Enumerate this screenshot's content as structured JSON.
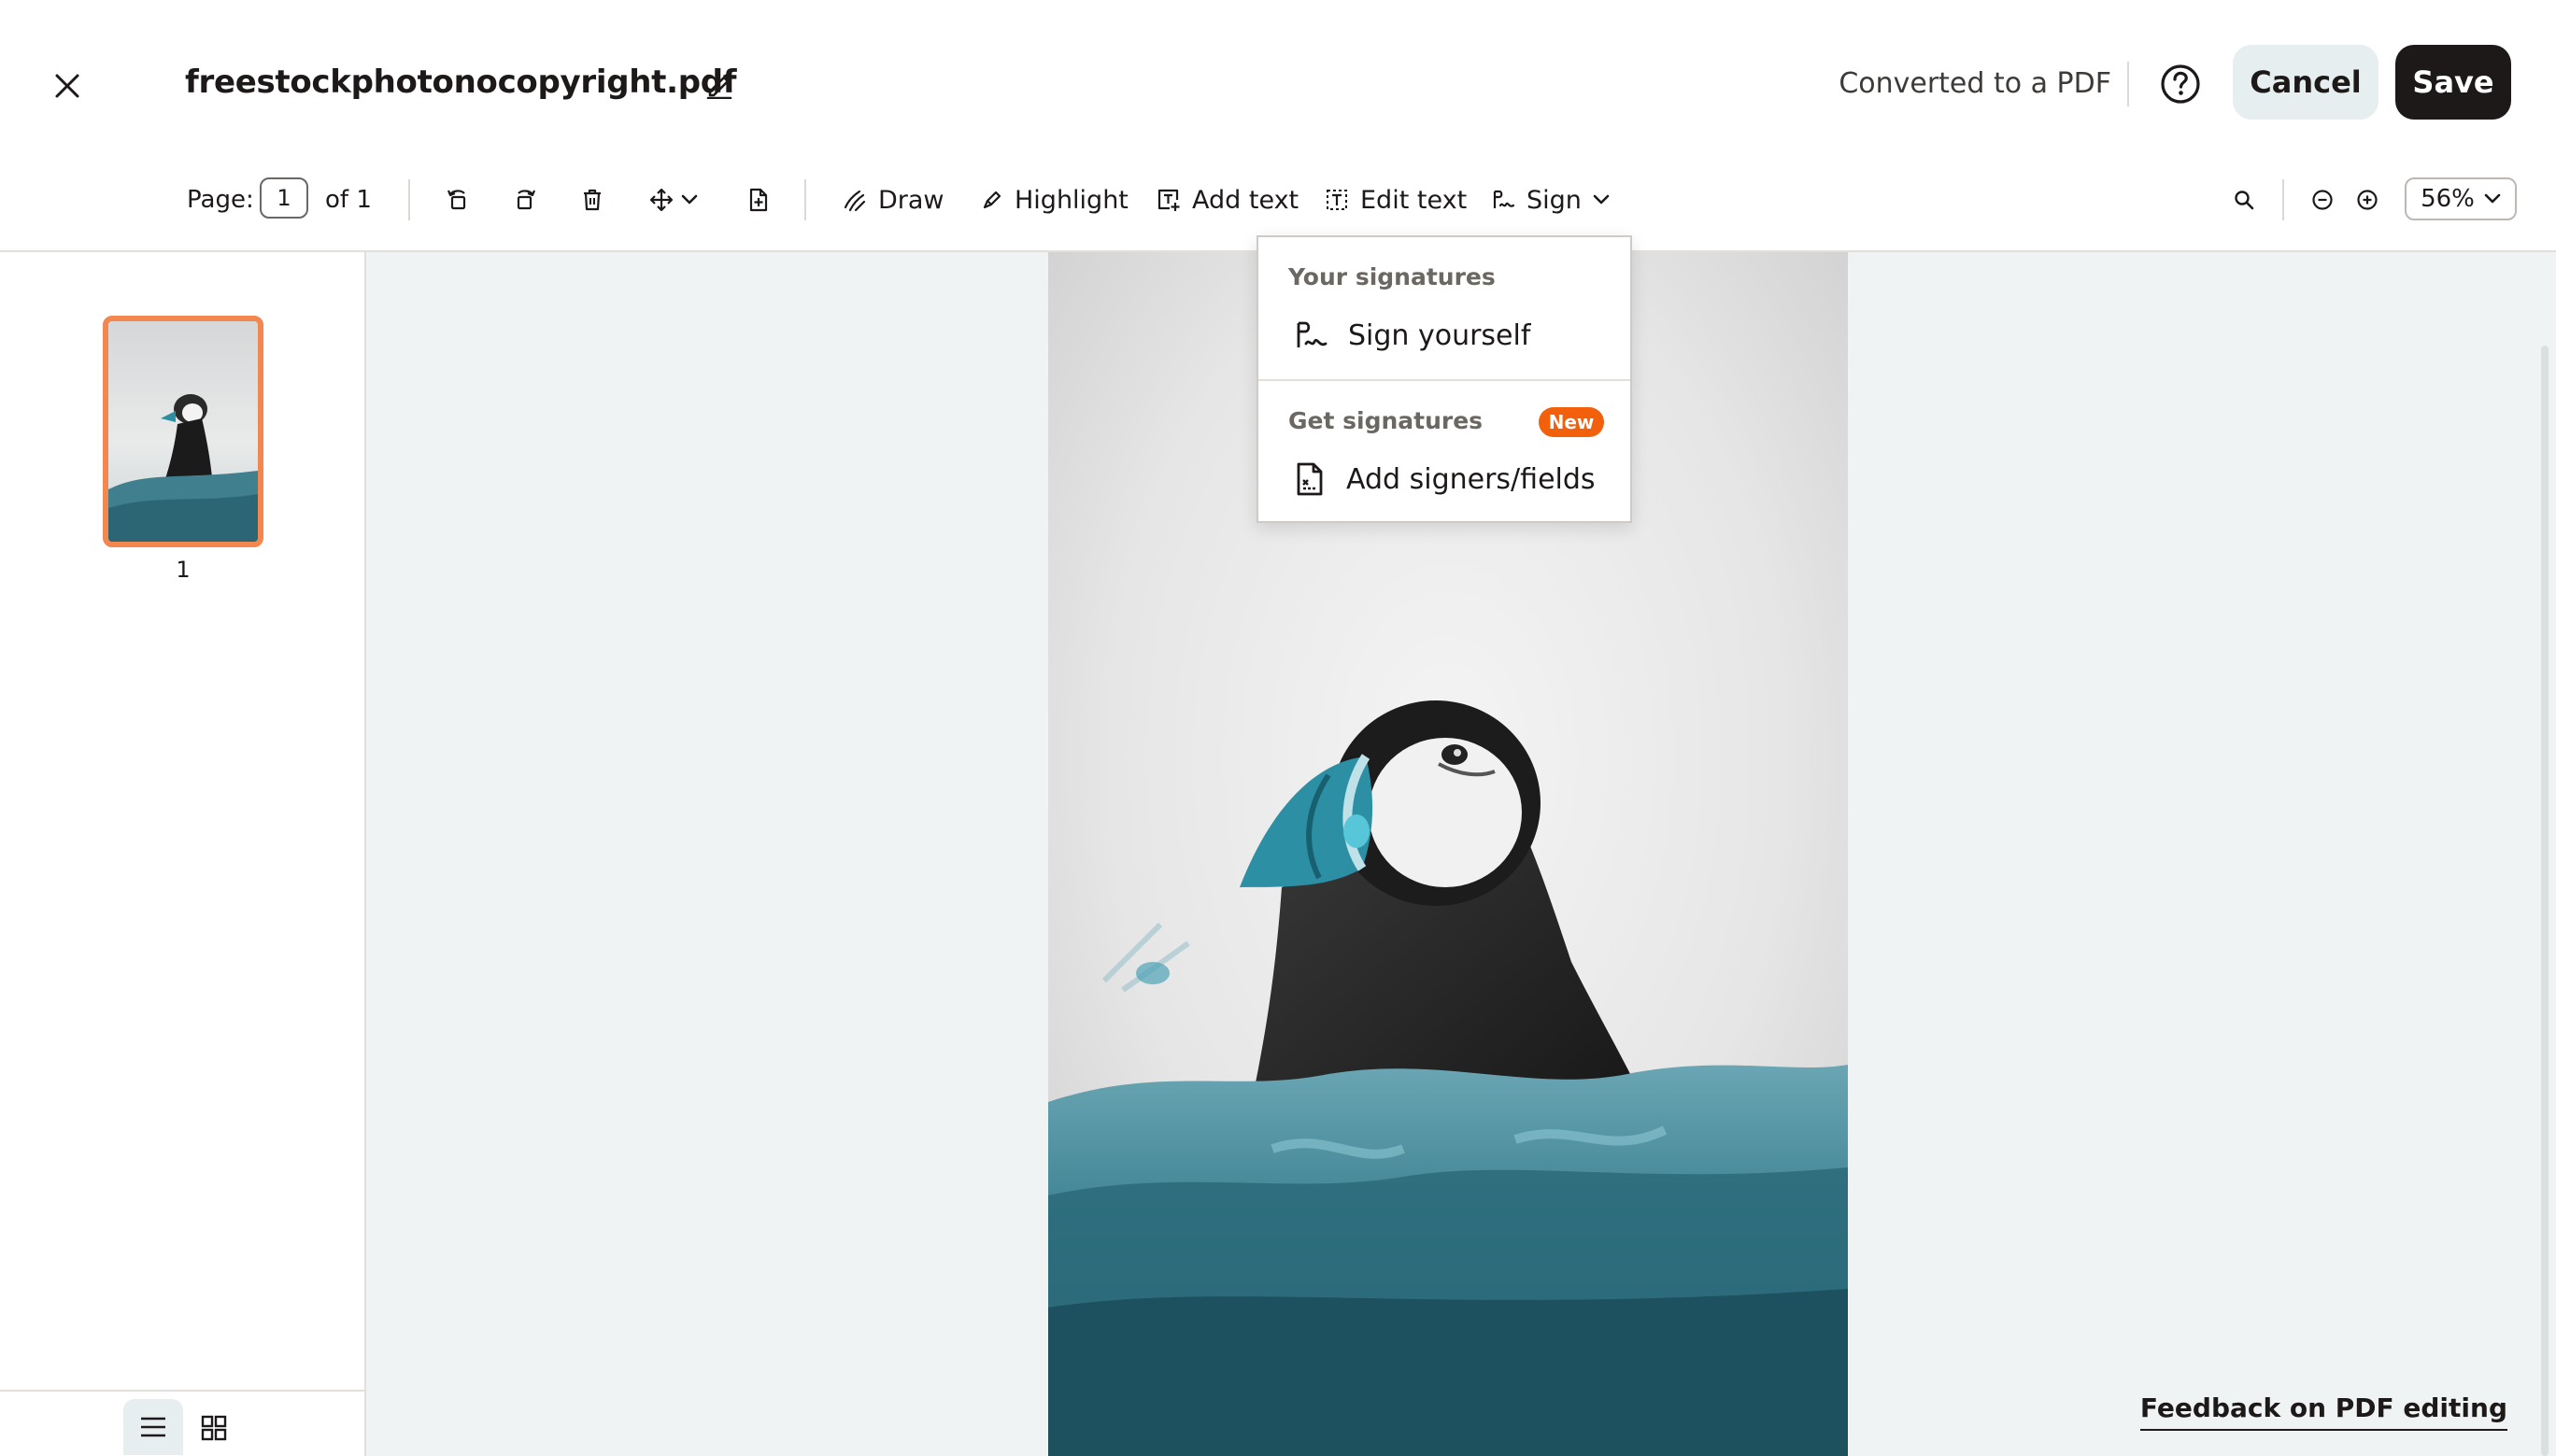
{
  "header": {
    "file_name": "freestockphotonocopyright.pdf",
    "status": "Converted to a PDF",
    "cancel_label": "Cancel",
    "save_label": "Save"
  },
  "toolbar": {
    "page_label": "Page:",
    "page_current": "1",
    "page_total": "of 1",
    "tools": {
      "draw": "Draw",
      "highlight": "Highlight",
      "add_text": "Add text",
      "edit_text": "Edit text",
      "sign": "Sign"
    },
    "zoom": "56%"
  },
  "sign_menu": {
    "your_signatures_title": "Your signatures",
    "sign_yourself": "Sign yourself",
    "get_signatures_title": "Get signatures",
    "new_badge": "New",
    "add_signers": "Add signers/fields"
  },
  "sidebar": {
    "thumbnails": [
      {
        "label": "1"
      }
    ]
  },
  "footer": {
    "feedback": "Feedback on PDF editing"
  },
  "colors": {
    "accent_orange": "#f2874f",
    "badge_orange": "#f2600c",
    "primary_dark": "#1e1919",
    "cancel_bg": "#e6eef0",
    "canvas_bg": "#f0f3f4"
  }
}
